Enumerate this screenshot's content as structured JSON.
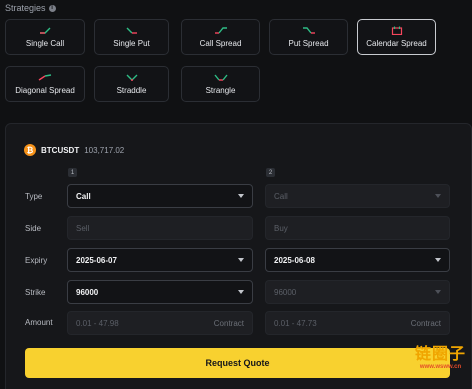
{
  "section": {
    "title": "Strategies"
  },
  "strategies": [
    {
      "label": "Single Call",
      "glyph": "single-call-glyph",
      "selected": false
    },
    {
      "label": "Single Put",
      "glyph": "single-put-glyph",
      "selected": false
    },
    {
      "label": "Call Spread",
      "glyph": "call-spread-glyph",
      "selected": false
    },
    {
      "label": "Put Spread",
      "glyph": "put-spread-glyph",
      "selected": false
    },
    {
      "label": "Calendar Spread",
      "glyph": "calendar-spread-glyph",
      "selected": true
    },
    {
      "label": "Diagonal Spread",
      "glyph": "diagonal-spread-glyph",
      "selected": false
    },
    {
      "label": "Straddle",
      "glyph": "straddle-glyph",
      "selected": false
    },
    {
      "label": "Strangle",
      "glyph": "strangle-glyph",
      "selected": false
    }
  ],
  "instrument": {
    "icon_letter": "₿",
    "symbol": "BTCUSDT",
    "price": "103,717.02"
  },
  "legs": [
    {
      "number": "1"
    },
    {
      "number": "2"
    }
  ],
  "rows": {
    "type": "Type",
    "side": "Side",
    "expiry": "Expiry",
    "strike": "Strike",
    "amount": "Amount"
  },
  "leg1": {
    "type": "Call",
    "side": "Sell",
    "expiry": "2025-06-07",
    "strike": "96000",
    "amount_placeholder": "0.01 - 47.98",
    "amount_unit": "Contract"
  },
  "leg2": {
    "type": "Call",
    "side": "Buy",
    "expiry": "2025-06-08",
    "strike": "96000",
    "amount_placeholder": "0.01 - 47.73",
    "amount_unit": "Contract"
  },
  "actions": {
    "request_quote": "Request Quote"
  },
  "watermark": {
    "text": "链圈子",
    "url": "www.wsww.cn"
  },
  "colors": {
    "accent_yellow": "#f8d12f",
    "up_green": "#2ebd85",
    "down_red": "#f6465d",
    "btc_orange": "#f7931a"
  }
}
